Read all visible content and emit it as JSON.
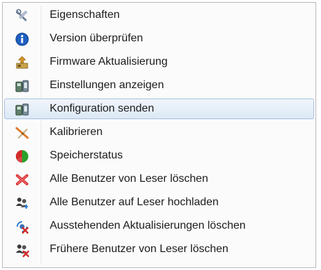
{
  "context_menu": {
    "items": [
      {
        "label": "Eigenschaften",
        "icon": "properties-wrench-icon"
      },
      {
        "label": "Version überprüfen",
        "icon": "info-icon"
      },
      {
        "label": "Firmware Aktualisierung",
        "icon": "firmware-update-icon"
      },
      {
        "label": "Einstellungen anzeigen",
        "icon": "reader-settings-icon"
      },
      {
        "label": "Konfiguration senden",
        "icon": "send-configuration-icon",
        "highlighted": true
      },
      {
        "label": "Kalibrieren",
        "icon": "calibrate-icon"
      },
      {
        "label": "Speicherstatus",
        "icon": "memory-status-pie-icon"
      },
      {
        "label": "Alle Benutzer von Leser löschen",
        "icon": "delete-users-x-icon"
      },
      {
        "label": "Alle Benutzer auf Leser hochladen",
        "icon": "upload-users-icon"
      },
      {
        "label": "Ausstehenden Aktualisierungen löschen",
        "icon": "clear-pending-updates-icon"
      },
      {
        "label": "Frühere Benutzer von Leser löschen",
        "icon": "delete-former-users-icon"
      }
    ],
    "colors": {
      "highlight_border": "#a7c1e0",
      "highlight_fill": "#dce8f6",
      "info_blue": "#1f5fbf",
      "delete_red": "#d42a2a",
      "pie_green": "#2aa12a"
    }
  }
}
